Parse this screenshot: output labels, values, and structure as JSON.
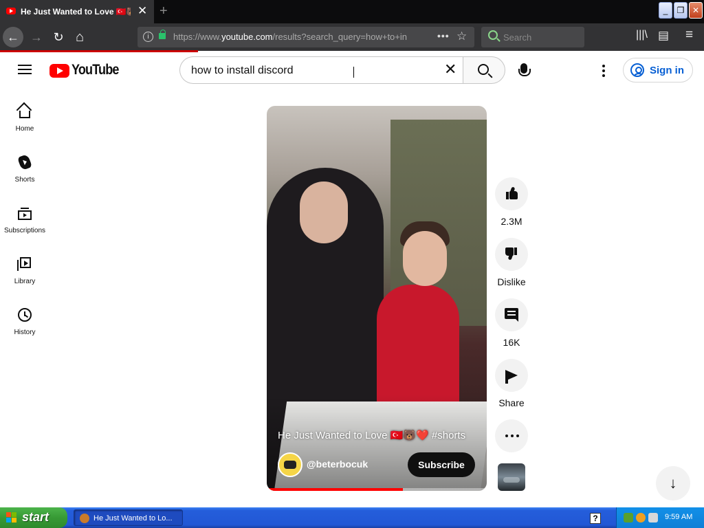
{
  "browser": {
    "tab_title": "He Just Wanted to Love 🇹🇷🐻❤️",
    "tab_close": "✕",
    "new_tab": "+",
    "url_prefix": "https://www.",
    "url_domain": "youtube.com",
    "url_rest": "/results?search_query=how+to+in",
    "search_placeholder": "Search",
    "page_actions": "•••",
    "bookmark_star": "☆",
    "back": "←",
    "forward": "→",
    "reload": "↻",
    "home": "⌂",
    "library": "|||\\",
    "sidebar_toggle": "▤",
    "menu": "≡",
    "win_min": "_",
    "win_max": "❐",
    "win_close": "✕"
  },
  "youtube": {
    "logo_text": "YouTube",
    "search_query": "how to install discord",
    "clear": "✕",
    "signin_label": "Sign in",
    "sidebar": [
      {
        "label": "Home",
        "icon": "home-icon"
      },
      {
        "label": "Shorts",
        "icon": "shorts-icon"
      },
      {
        "label": "Subscriptions",
        "icon": "subscriptions-icon"
      },
      {
        "label": "Library",
        "icon": "library-icon"
      },
      {
        "label": "History",
        "icon": "history-icon"
      }
    ],
    "short": {
      "title": "He Just Wanted to Love 🇹🇷🐻❤️ #shorts",
      "channel": "@beterbocuk",
      "subscribe_label": "Subscribe",
      "progress_fraction": 0.62
    },
    "actions": {
      "likes": "2.3M",
      "dislike": "Dislike",
      "comments": "16K",
      "share": "Share"
    },
    "next_arrow": "↓"
  },
  "taskbar": {
    "start_label": "start",
    "task_label": "He Just Wanted to Lo...",
    "help": "?",
    "clock": "9:59 AM"
  },
  "colors": {
    "youtube_red": "#ff0000",
    "link_blue": "#065fd4",
    "firefox_dark": "#323234",
    "xp_blue": "#245edb",
    "xp_green": "#379a35"
  }
}
